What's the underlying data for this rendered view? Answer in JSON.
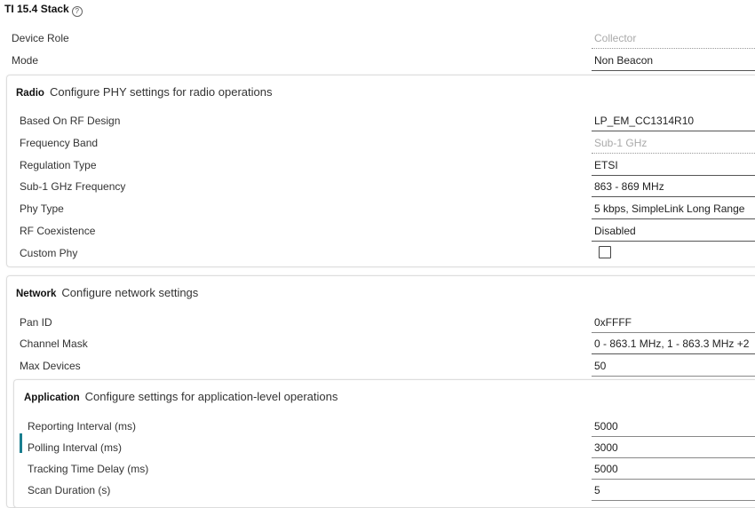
{
  "title": "TI 15.4 Stack",
  "help_glyph": "?",
  "top_fields": [
    {
      "label": "Device Role",
      "value": "Collector"
    },
    {
      "label": "Mode",
      "value": "Non Beacon"
    }
  ],
  "radio": {
    "heading": "Radio",
    "description": "Configure PHY settings for radio operations",
    "fields": [
      {
        "label": "Based On RF Design",
        "value": "LP_EM_CC1314R10"
      },
      {
        "label": "Frequency Band",
        "value": "Sub-1 GHz"
      },
      {
        "label": "Regulation Type",
        "value": "ETSI"
      },
      {
        "label": "Sub-1 GHz Frequency",
        "value": "863 - 869 MHz"
      },
      {
        "label": "Phy Type",
        "value": "5 kbps, SimpleLink Long Range"
      },
      {
        "label": "RF Coexistence",
        "value": "Disabled"
      },
      {
        "label": "Custom Phy",
        "checked": false
      }
    ]
  },
  "network": {
    "heading": "Network",
    "description": "Configure network settings",
    "fields": [
      {
        "label": "Pan ID",
        "value": "0xFFFF"
      },
      {
        "label": "Channel Mask",
        "value": "0 - 863.1 MHz, 1 - 863.3 MHz +2"
      },
      {
        "label": "Max Devices",
        "value": "50"
      }
    ]
  },
  "application": {
    "heading": "Application",
    "description": "Configure settings for application-level operations",
    "fields": [
      {
        "label": "Reporting Interval (ms)",
        "value": "5000"
      },
      {
        "label": "Polling Interval (ms)",
        "value": "3000"
      },
      {
        "label": "Tracking Time Delay (ms)",
        "value": "5000"
      },
      {
        "label": "Scan Duration (s)",
        "value": "5"
      }
    ]
  },
  "colors": {
    "focus_accent": "#1a7e8f"
  }
}
